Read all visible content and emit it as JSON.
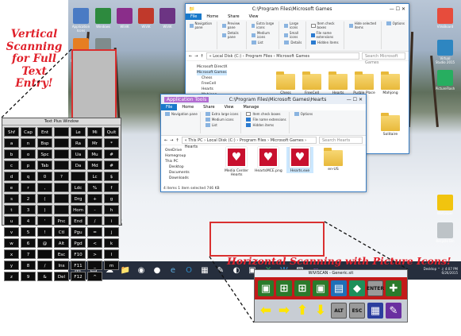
{
  "annotations": {
    "vertical": [
      "Vertical",
      "Scanning",
      "for Full",
      "Text",
      "Entry!"
    ],
    "horizontal": "Horizontal Scanning with Picture Icons!"
  },
  "colors": {
    "annotation": "#e0202a",
    "scan_box": "#d93030",
    "dashed": "#111111"
  },
  "desktop_icons": [
    {
      "label": "Application Icons",
      "icon": "app-icon"
    },
    {
      "label": "Windows",
      "icon": "windows-icon"
    },
    {
      "label": "WiViK",
      "icon": "wivik-icon"
    },
    {
      "label": "WiViK",
      "icon": "wivik-icon"
    },
    {
      "label": "WiViK",
      "icon": "wivik-icon"
    },
    {
      "label": "Ask DirectCenter",
      "icon": "ask-icon"
    },
    {
      "label": "Microsoft Games",
      "icon": "games-icon"
    }
  ],
  "right_icons": [
    {
      "label": "ViVoBoard"
    },
    {
      "label": "Virtual Studio 2015"
    },
    {
      "label": "PictureFlash"
    },
    {
      "label": "Wallpaper"
    },
    {
      "label": "Recycle Bin"
    }
  ],
  "back_window": {
    "title": "C:\\Program Files\\Microsoft Games",
    "tabs": [
      "File",
      "Home",
      "Share",
      "View"
    ],
    "address": "« Local Disk (C:) › Program Files › Microsoft Games",
    "search": "Search Microsoft Games",
    "nav": [
      "Microsoft DirectX",
      "Microsoft Games",
      "Chess",
      "FreeCell",
      "Hearts",
      "Mahjong",
      "Minesweeper",
      "Solitaire"
    ],
    "folders": [
      "Chess",
      "FreeCell",
      "Hearts",
      "Purble Place",
      "Mahjong",
      "Solitaire"
    ],
    "ribbon": {
      "layout": [
        "Navigation pane",
        "Preview pane",
        "Details pane",
        "Extra large icons",
        "Large icons",
        "Medium icons",
        "Small icons",
        "List",
        "Details"
      ],
      "show": [
        "Item check boxes",
        "File name extensions",
        "Hidden items"
      ],
      "buttons": [
        "Hide selected items",
        "Options"
      ]
    }
  },
  "front_window": {
    "title": "C:\\Program Files\\Microsoft Games\\Hearts",
    "context_tab": "Application Tools",
    "tabs": [
      "File",
      "Home",
      "Share",
      "View",
      "Manage"
    ],
    "address": "« This PC › Local Disk (C:) › Program Files › Microsoft Games › Hearts",
    "search": "Search Hearts",
    "nav": [
      "OneDrive",
      "Homegroup",
      "This PC",
      "Desktop",
      "Documents",
      "Downloads"
    ],
    "files": [
      "Media Center Hearts",
      "HeartsMCE.png",
      "Hearts.exe",
      "en-US"
    ],
    "status": "4 items    1 item selected  746 KB"
  },
  "keyboard": {
    "title": "Text Plus Window",
    "keys": [
      "Shf",
      "Cap",
      "Ent",
      "",
      "Le",
      "Mi",
      "Quit",
      "a",
      "n",
      "Bsp",
      "",
      "Ra",
      "Mr",
      "*",
      "b",
      "o",
      "Spc",
      "",
      "Ua",
      "Mu",
      "#",
      "c",
      "p",
      "Tab",
      "",
      "Da",
      "Md",
      "#",
      "d",
      "q",
      "0",
      "?",
      "",
      "Lc",
      "$",
      "e",
      "r",
      ",",
      "",
      "Ldc",
      "%",
      "f",
      "s",
      "2",
      "(",
      "",
      "Drg",
      "+",
      "g",
      "t",
      "3",
      ")",
      "",
      "Hom",
      "-",
      "h",
      "u",
      "4",
      "'",
      "Pnc",
      "End",
      "/",
      "i",
      "v",
      "5",
      "!",
      "Ctl",
      "Pgu",
      "=",
      "j",
      "w",
      "6",
      "@",
      "Alt",
      "Pgd",
      "<",
      "k",
      "x",
      "7",
      "",
      "Esc",
      "F10",
      ">",
      "l",
      "y",
      "8",
      "/",
      "Ins",
      "F11",
      "_",
      "m",
      "z",
      "9",
      "&",
      "Del",
      "F12",
      "^"
    ]
  },
  "picture_bar": {
    "title": "WiViSCAN - Generic.sit",
    "icons_row1": [
      "window-icon",
      "windows-icon",
      "windows-icon",
      "window-icon",
      "window-icon",
      "tag-icon",
      "ENTER",
      "crossroad-icon"
    ],
    "icons_row2": [
      "left-arrow-icon",
      "right-arrow-icon",
      "up-arrow-icon",
      "down-arrow-icon",
      "ALT",
      "ESC",
      "grid-icon",
      "pen-icon"
    ]
  },
  "tray": {
    "lang": "Desktop",
    "time": "4:07 PM",
    "date": "6/26/2015"
  }
}
